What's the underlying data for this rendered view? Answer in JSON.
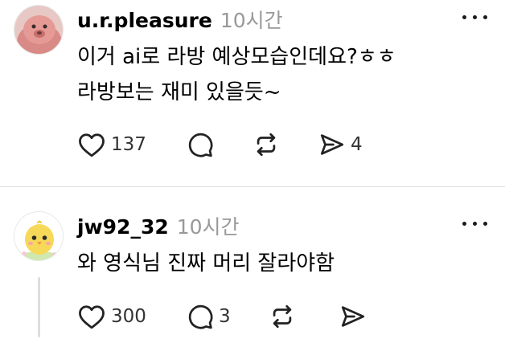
{
  "comments": [
    {
      "username": "u.r.pleasure",
      "time": "10시간",
      "lines": [
        "이거 ai로 라방 예상모습인데요?ㅎㅎ",
        "라방보는 재미 있을듯~"
      ],
      "likes": "137",
      "replies": "",
      "reposts": "",
      "shares": "4",
      "avatar_icon": "pink-creature-avatar"
    },
    {
      "username": "jw92_32",
      "time": "10시간",
      "lines": [
        "와 영식님 진짜 머리 잘라야함"
      ],
      "likes": "300",
      "replies": "3",
      "reposts": "",
      "shares": "",
      "avatar_icon": "yellow-chick-avatar"
    }
  ],
  "icons": [
    "heart-icon",
    "comment-icon",
    "repost-icon",
    "share-icon",
    "more-icon"
  ],
  "colors": {
    "time_gray": "#999999",
    "divider": "#dcdcdc",
    "thread_line": "#dddddd"
  }
}
